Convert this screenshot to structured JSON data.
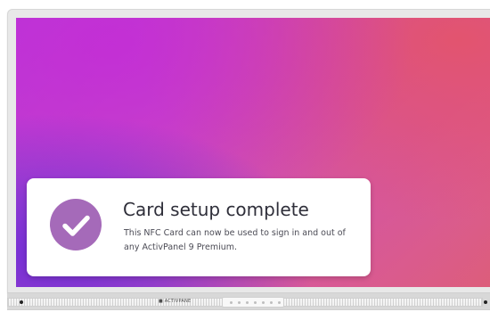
{
  "display": {
    "brand_mini": "■ ACTIVPANEL ■"
  },
  "notification": {
    "title": "Card setup complete",
    "message": "This NFC Card can now be used to sign in and out of any ActivPanel 9 Premium."
  },
  "icons": {
    "success": "checkmark-circle-icon"
  },
  "colors": {
    "accent": "#a56ab9",
    "card": "#ffffff",
    "title_text": "#2f2f3a",
    "body_text": "#4b4b55",
    "screen_purple": "#7f3adf",
    "screen_magenta": "#c947c8",
    "screen_pink": "#dc5b86"
  }
}
